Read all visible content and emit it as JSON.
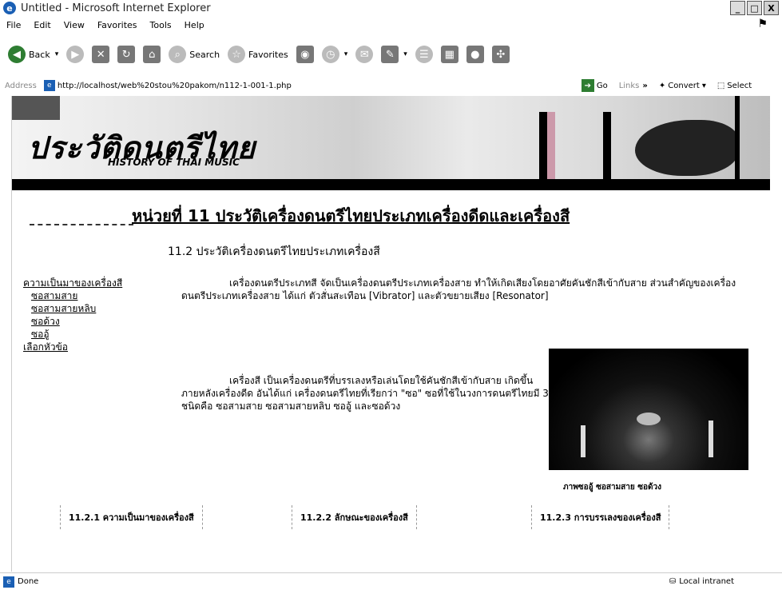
{
  "window": {
    "title": "Untitled - Microsoft Internet Explorer",
    "minimize_glyph": "_",
    "maximize_glyph": "□",
    "close_glyph": "X"
  },
  "menu": [
    "File",
    "Edit",
    "View",
    "Favorites",
    "Tools",
    "Help"
  ],
  "toolbar": {
    "back": "Back",
    "search": "Search",
    "favorites": "Favorites"
  },
  "address": {
    "label": "Address",
    "url": "http://localhost/web%20stou%20pakom/n112-1-001-1.php",
    "go": "Go",
    "links": "Links",
    "chevron": "»",
    "convert": "Convert",
    "select": "Select"
  },
  "banner": {
    "title": "ประวัติดนตรีไทย",
    "subtitle": "HISTORY OF THAI MUSIC"
  },
  "page": {
    "heading": "หน่วยที่ 11 ประวัติเครื่องดนตรีไทยประเภทเครื่องดีดและเครื่องสี",
    "subheading": "11.2 ประวัติเครื่องดนตรีไทยประเภทเครื่องสี",
    "sidebar": [
      "ความเป็นมาของเครื่องสี",
      "ซอสามสาย",
      "ซอสามสายหลิบ",
      "ซอด้วง",
      "ซออู้",
      "เลือกหัวข้อ"
    ],
    "paragraph1": "เครื่องดนตรีประเภทสี จัดเป็นเครื่องดนตรีประเภทเครื่องสาย ทำให้เกิดเสียงโดยอาศัยคันชักสีเข้ากับสาย ส่วนสำคัญของเครื่องดนตรีประเภทเครื่องสาย ได้แก่ ตัวสั่นสะเทือน [Vibrator] และตัวขยายเสียง [Resonator]",
    "paragraph2": "เครื่องสี เป็นเครื่องดนตรีที่บรรเลงหรือเล่นโดยใช้คันชักสีเข้ากับสาย เกิดขึ้นภายหลังเครื่องดีด อันได้แก่ เครื่องดนตรีไทยที่เรียกว่า \"ซอ\" ซอที่ใช้ในวงการดนตรีไทยมี 3 ชนิดคือ ซอสามสาย ซอสามสายหลิบ ซออู้ และซอด้วง",
    "caption": "ภาพซออู้ ซอสามสาย ซอด้วง",
    "nav": [
      "11.2.1 ความเป็นมาของเครื่องสี",
      "11.2.2 ลักษณะของเครื่องสี",
      "11.2.3 การบรรเลงของเครื่องสี"
    ]
  },
  "status": {
    "text": "Done",
    "zone": "Local intranet"
  }
}
